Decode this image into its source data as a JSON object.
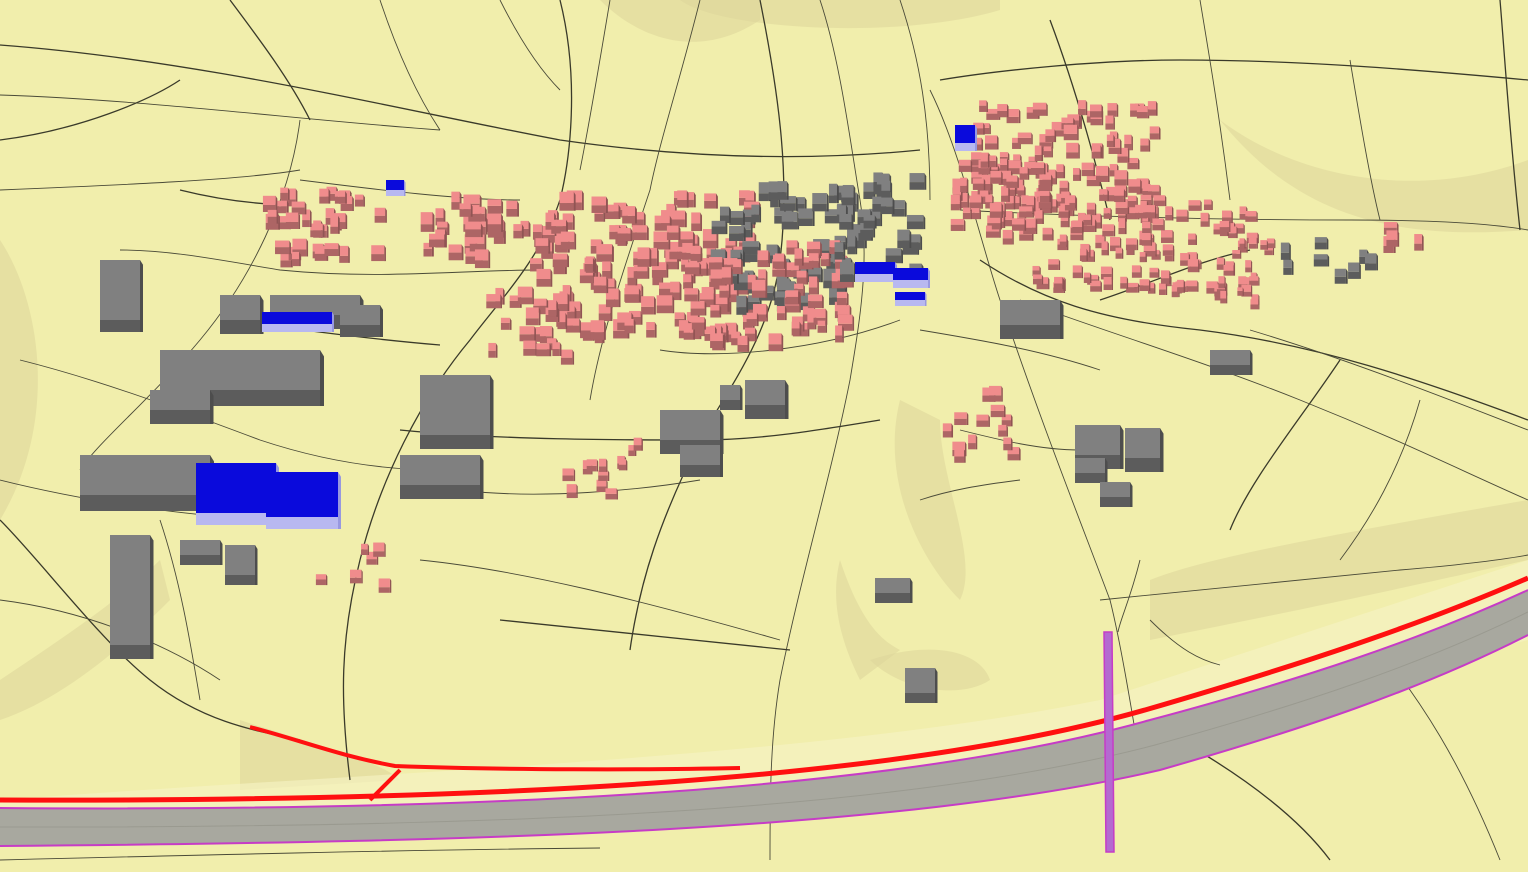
{
  "scene": {
    "view": "3d-perspective-terrain",
    "layers": [
      {
        "name": "terrain",
        "color": "#f1eeac"
      },
      {
        "name": "roads",
        "color": "#3a3a2a"
      },
      {
        "name": "residential-buildings",
        "color": "#f08c8c"
      },
      {
        "name": "other-buildings",
        "color": "#808080"
      },
      {
        "name": "highlighted-buildings",
        "color": "#0a0adc"
      },
      {
        "name": "motorway",
        "color": "#a9a9a0"
      },
      {
        "name": "motorway-edge",
        "color": "#cc44cc"
      },
      {
        "name": "noise-barrier",
        "color": "#ff0000"
      }
    ]
  }
}
